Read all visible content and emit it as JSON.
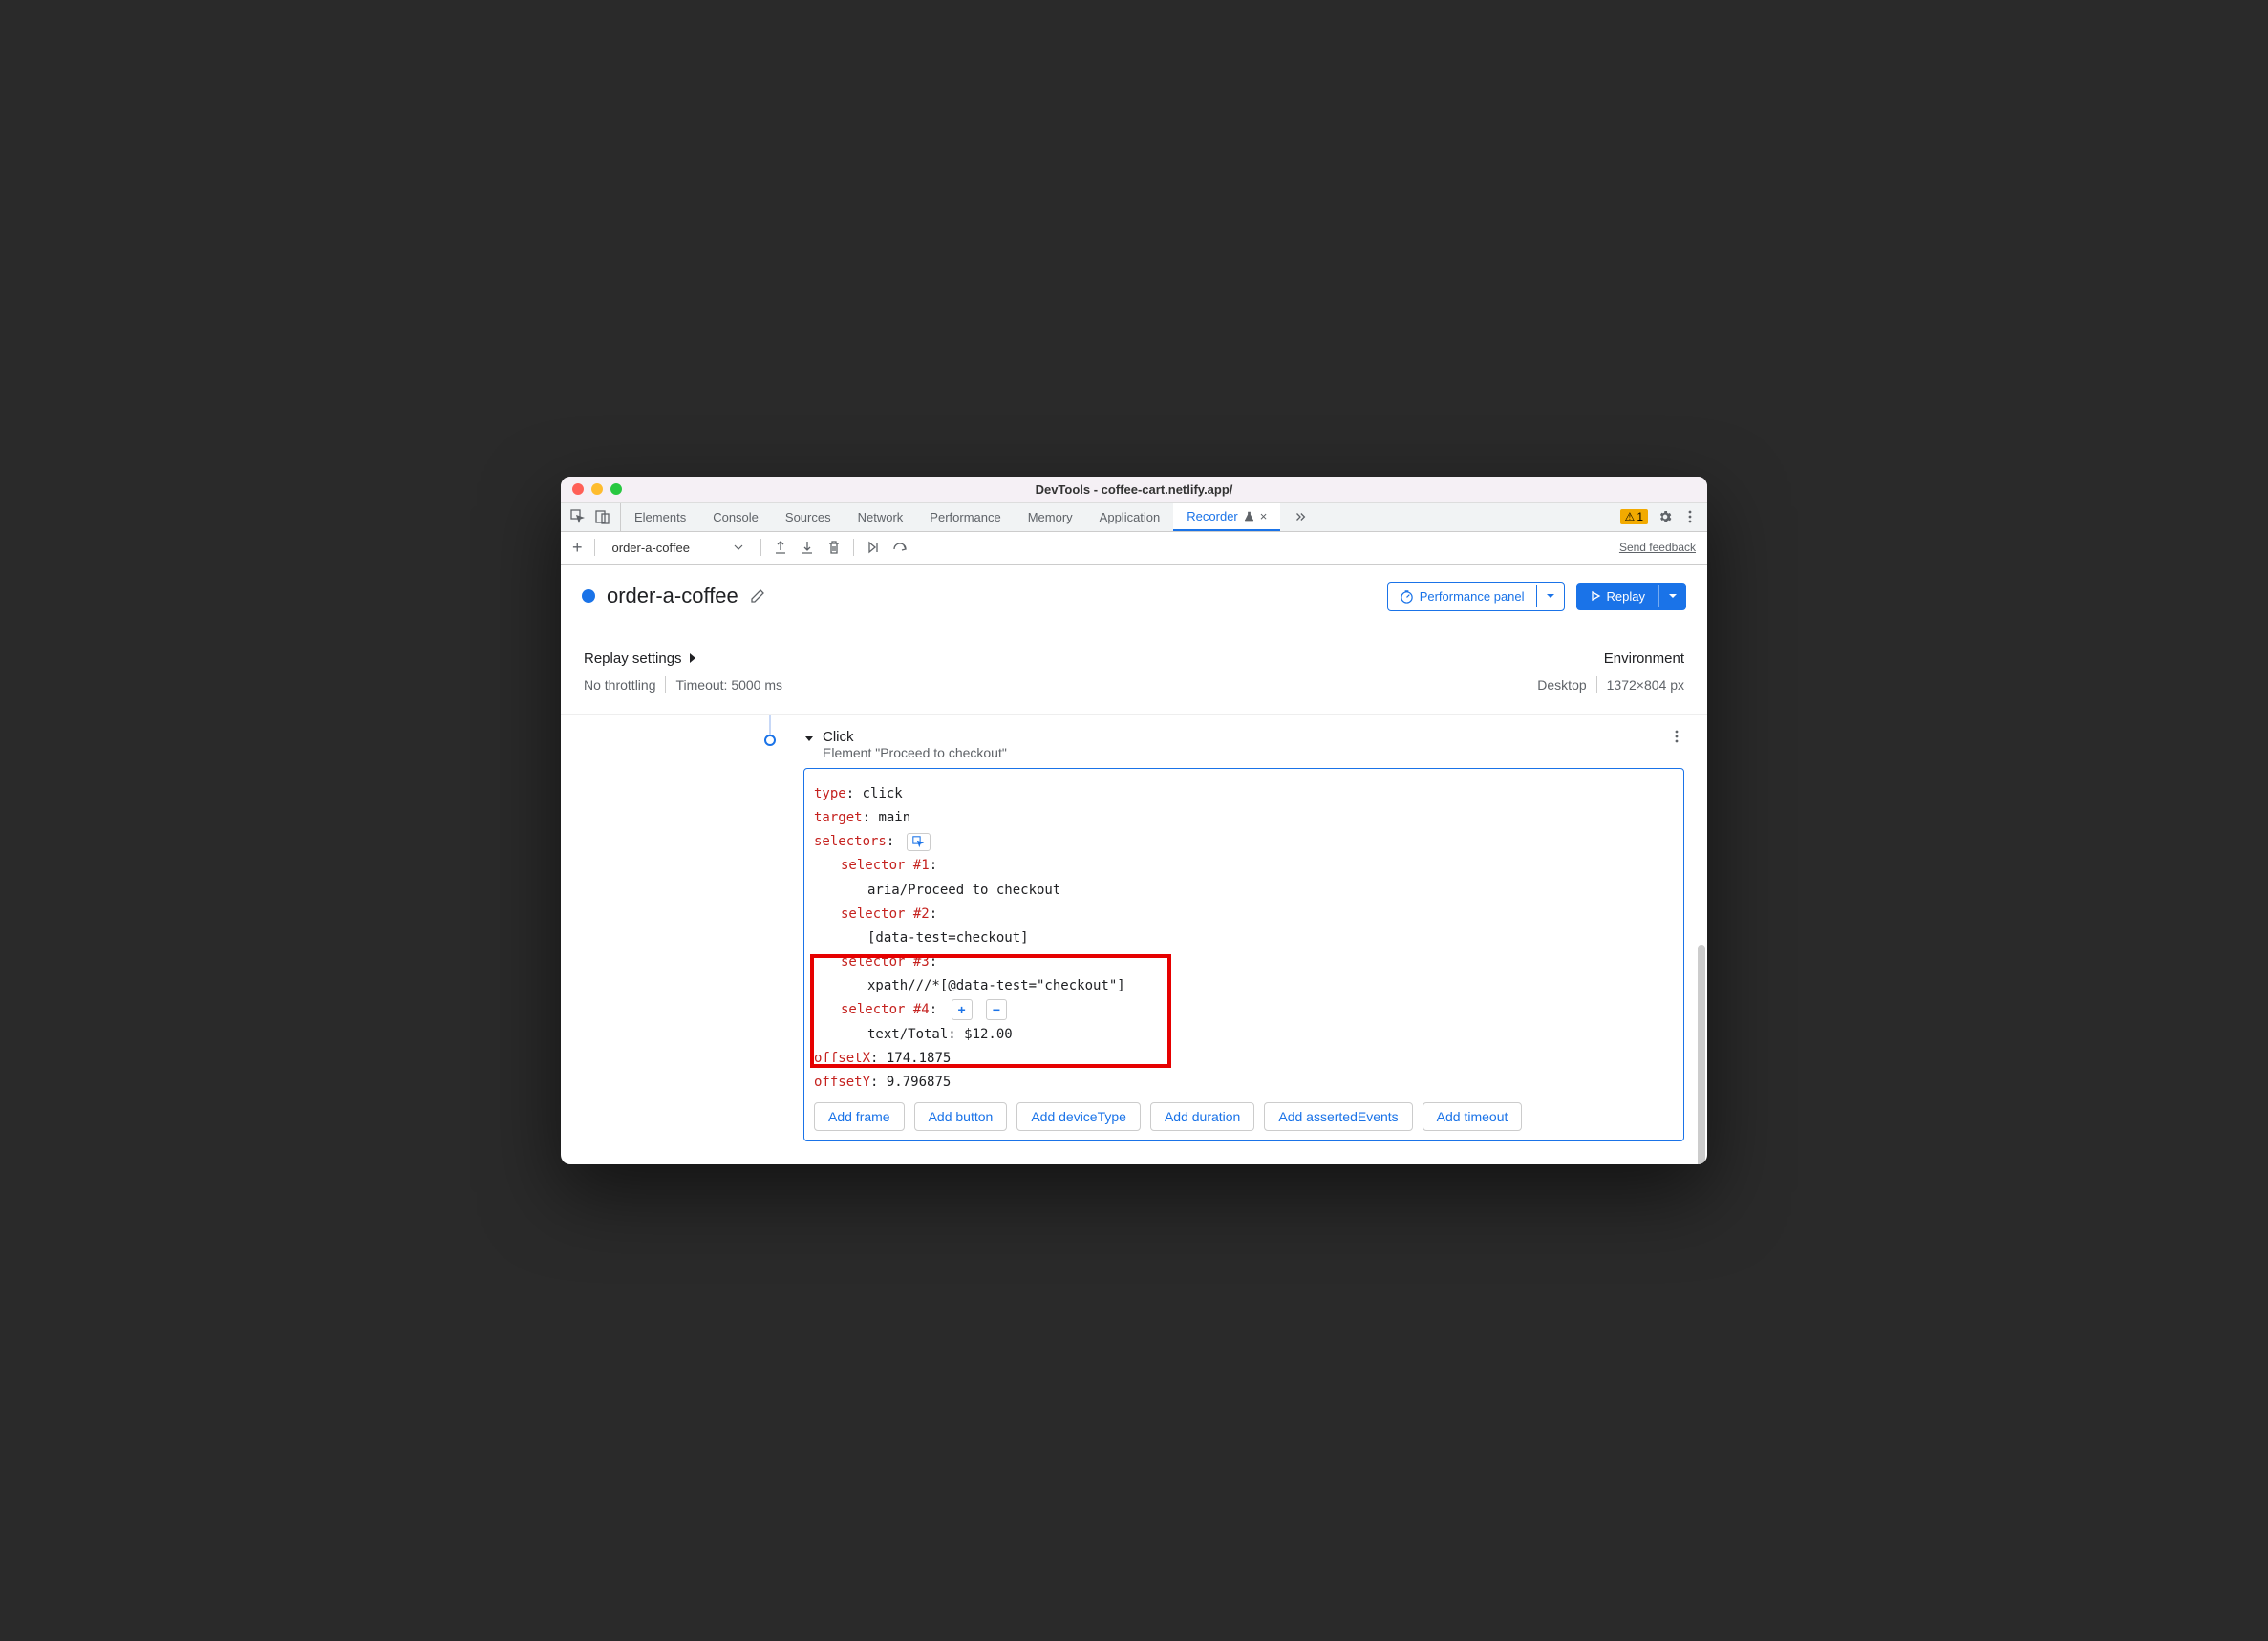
{
  "window": {
    "title": "DevTools - coffee-cart.netlify.app/"
  },
  "tabs": {
    "items": [
      "Elements",
      "Console",
      "Sources",
      "Network",
      "Performance",
      "Memory",
      "Application",
      "Recorder"
    ],
    "active": "Recorder",
    "warning_count": "1"
  },
  "toolbar": {
    "recording_name": "order-a-coffee",
    "feedback": "Send feedback"
  },
  "header": {
    "title": "order-a-coffee",
    "perf_button": "Performance panel",
    "replay_button": "Replay"
  },
  "settings": {
    "replay_title": "Replay settings",
    "throttling": "No throttling",
    "timeout": "Timeout: 5000 ms",
    "env_title": "Environment",
    "device": "Desktop",
    "dimensions": "1372×804 px"
  },
  "step": {
    "title": "Click",
    "subtitle": "Element \"Proceed to checkout\"",
    "detail": {
      "type_key": "type",
      "type_val": " click",
      "target_key": "target",
      "target_val": " main",
      "selectors_key": "selectors",
      "s1_key": "selector #1",
      "s1_val": "aria/Proceed to checkout",
      "s2_key": "selector #2",
      "s2_val": "[data-test=checkout]",
      "s3_key": "selector #3",
      "s3_val": "xpath///*[@data-test=\"checkout\"]",
      "s4_key": "selector #4",
      "s4_val": "text/Total: $12.00",
      "offx_key": "offsetX",
      "offx_val": " 174.1875",
      "offy_key": "offsetY",
      "offy_val": " 9.796875"
    },
    "add_buttons": [
      "Add frame",
      "Add button",
      "Add deviceType",
      "Add duration",
      "Add assertedEvents",
      "Add timeout"
    ]
  }
}
